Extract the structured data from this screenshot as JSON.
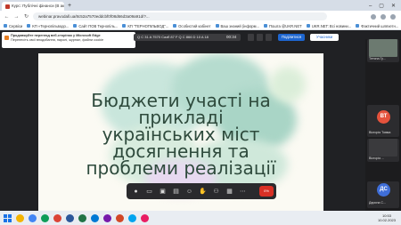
{
  "browser": {
    "tabs": [
      {
        "label": "Курс: Публічні фінанси (В акти",
        "active": true
      },
      {
        "label": "",
        "active": false
      }
    ],
    "new_tab": "+",
    "url": "webinar.pravodall.ua/8c52a7570eddcbf0f08d66d3a09a91d/?..."
  },
  "bookmarks": [
    "Сервіси",
    "КП «Тернопільводо...",
    "Сайт ПОВ Тернопіль...",
    "КП \"ТЕРНОПІЛЬВОД\"...",
    "Особистий кабінет",
    "Ваш знаний (інформ...",
    "Пошта @UKR.NET",
    "UKR.NET: Всі новини...",
    "Фактичний шляхетн..."
  ],
  "app": {
    "notice": {
      "title": "Продовжуйте перегляд веб-сторінок у Microsoft Edge",
      "body": "Перенесіть свої вподобання, паролі, журнал, файли cookie"
    },
    "status_text": "Q C 31 A 7570 Caзб 87 F Q C 866 D 10 A 18",
    "timer": "00:34",
    "share_button": "Поділитися",
    "participants_button": "Учасники"
  },
  "slide": {
    "title": "Бюджети участі на\nприкладі\nукраїнських міст\nдосягнення та\nпроблеми реалізації"
  },
  "toolbar": {
    "end_label": "0%"
  },
  "participants": [
    {
      "name": "Тетяна Гу...",
      "initials": "",
      "color": "#6c7a70"
    },
    {
      "name": "Вікторія Товма",
      "initials": "ВТ",
      "color": "#e5533d"
    },
    {
      "name": "Вікторія ...",
      "initials": "",
      "color": "#3a3a3d"
    },
    {
      "name": "Дарина С...",
      "initials": "ДС",
      "color": "#3f6ed8"
    }
  ],
  "taskbar": {
    "time": "10:53",
    "date": "10.02.2023"
  },
  "colors": {
    "accent": "#1e66d0",
    "end_call": "#d93025",
    "slide_text": "#2e4a3c"
  }
}
